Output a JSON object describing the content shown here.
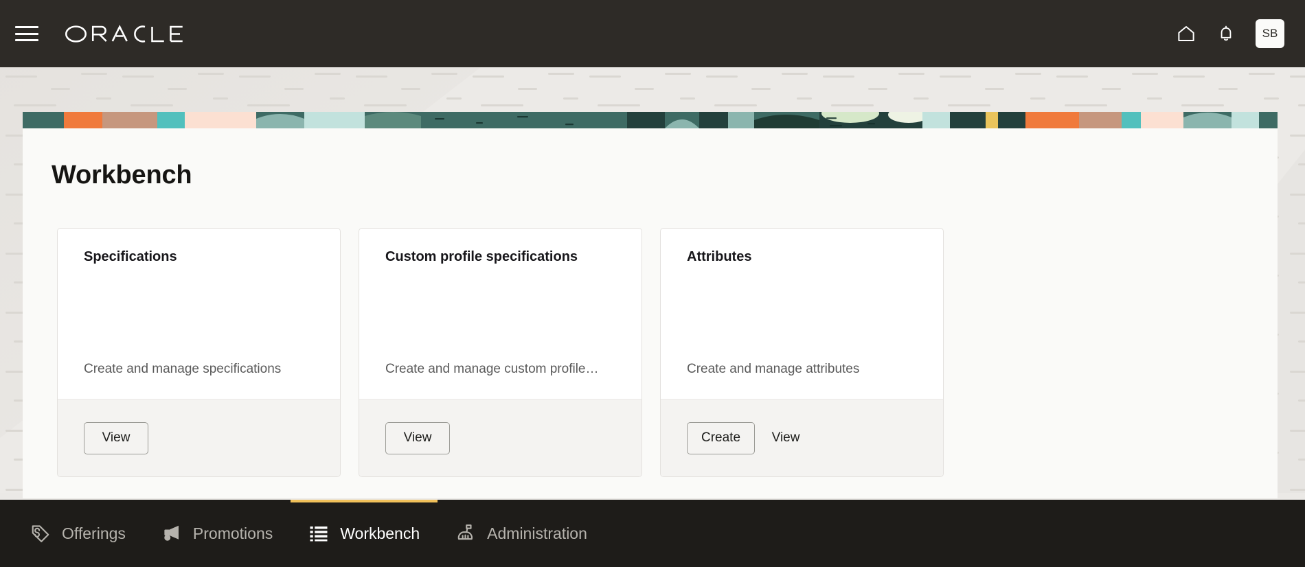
{
  "topbar": {
    "menu_label": "Main menu",
    "brand": "ORACLE",
    "home_icon": "home-icon",
    "notifications_icon": "bell-icon",
    "avatar_initials": "SB"
  },
  "page": {
    "title": "Workbench"
  },
  "cards": [
    {
      "title": "Specifications",
      "description": "Create and manage specifications",
      "actions": [
        {
          "label": "View",
          "style": "outline"
        }
      ]
    },
    {
      "title": "Custom profile specifications",
      "description": "Create and manage custom profile…",
      "actions": [
        {
          "label": "View",
          "style": "outline"
        }
      ]
    },
    {
      "title": "Attributes",
      "description": "Create and manage attributes",
      "actions": [
        {
          "label": "Create",
          "style": "outline"
        },
        {
          "label": "View",
          "style": "ghost"
        }
      ]
    }
  ],
  "bottom_nav": {
    "active_indicator_color": "#f0c05a",
    "items": [
      {
        "label": "Offerings",
        "icon": "tag-icon",
        "active": false
      },
      {
        "label": "Promotions",
        "icon": "megaphone-icon",
        "active": false
      },
      {
        "label": "Workbench",
        "icon": "list-icon",
        "active": true
      },
      {
        "label": "Administration",
        "icon": "broom-icon",
        "active": false
      }
    ]
  },
  "colors": {
    "topbar_bg": "#2e2b27",
    "bottomnav_bg": "#1e1c19",
    "page_bg": "#eceae7",
    "panel_bg": "#fafaf8",
    "card_bg": "#ffffff",
    "card_footer_bg": "#f4f3f1",
    "accent": "#f0c05a"
  }
}
